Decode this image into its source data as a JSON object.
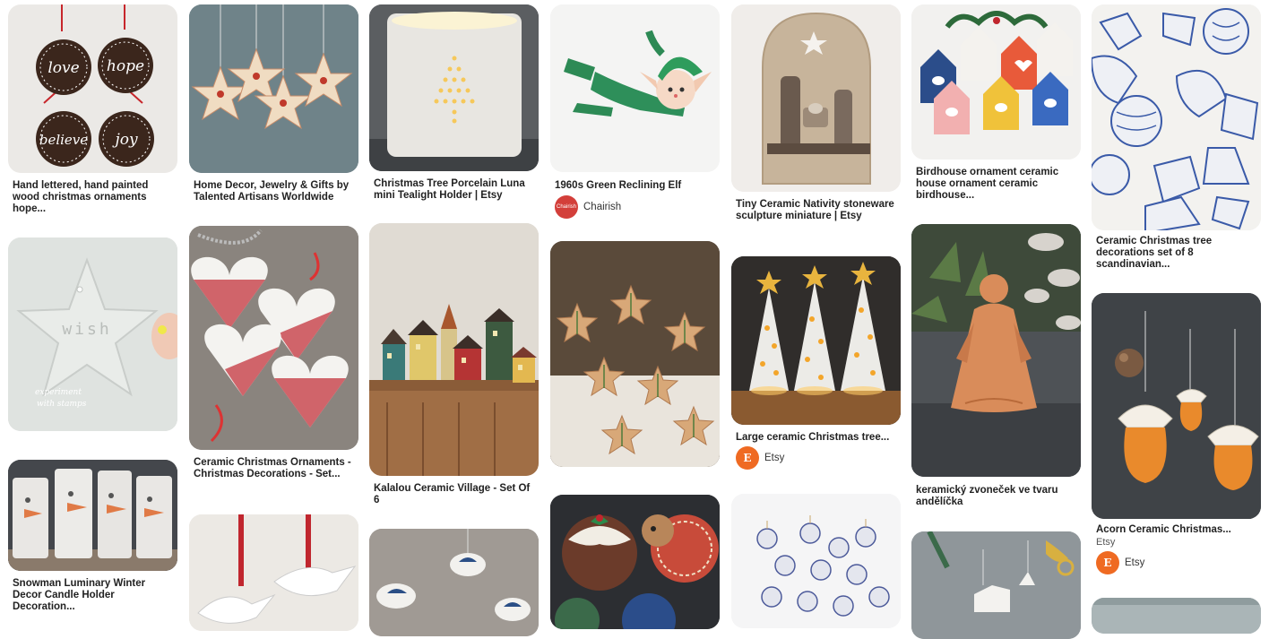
{
  "pins": {
    "p1": {
      "title": "Hand lettered, hand painted wood christmas ornaments hope..."
    },
    "p2": {
      "title": ""
    },
    "p3": {
      "title": "Snowman Luminary Winter Decor Candle Holder Decoration..."
    },
    "p4": {
      "title": "Home Decor, Jewelry & Gifts by Talented Artisans Worldwide"
    },
    "p5": {
      "title": "Ceramic Christmas Ornaments - Christmas Decorations - Set..."
    },
    "p6": {
      "title": ""
    },
    "p7": {
      "title": "Christmas Tree Porcelain Luna mini Tealight Holder | Etsy"
    },
    "p8": {
      "title": "Kalalou Ceramic Village - Set Of 6"
    },
    "p9": {
      "title": ""
    },
    "p10": {
      "title": "1960s Green Reclining Elf",
      "source": "Chairish",
      "avatar": "Chairish"
    },
    "p11": {
      "title": ""
    },
    "p12": {
      "title": ""
    },
    "p13": {
      "title": "Tiny Ceramic Nativity stoneware sculpture miniature | Etsy"
    },
    "p14": {
      "title": "Large ceramic Christmas tree...",
      "source": "Etsy",
      "avatar": "E"
    },
    "p15": {
      "title": ""
    },
    "p16": {
      "title": "Birdhouse ornament ceramic house ornament ceramic birdhouse..."
    },
    "p17": {
      "title": "keramický zvoneček ve tvaru andělíčka"
    },
    "p18": {
      "title": ""
    },
    "p19": {
      "title": "Ceramic Christmas tree decorations set of 8 scandinavian..."
    },
    "p20": {
      "title": "Acorn Ceramic Christmas...",
      "subtitle": "Etsy",
      "source": "Etsy",
      "avatar": "E"
    },
    "p21": {
      "title": ""
    }
  },
  "colors": {
    "brand_etsy": "#ef6a22",
    "brand_chairish": "#d33f3a"
  }
}
